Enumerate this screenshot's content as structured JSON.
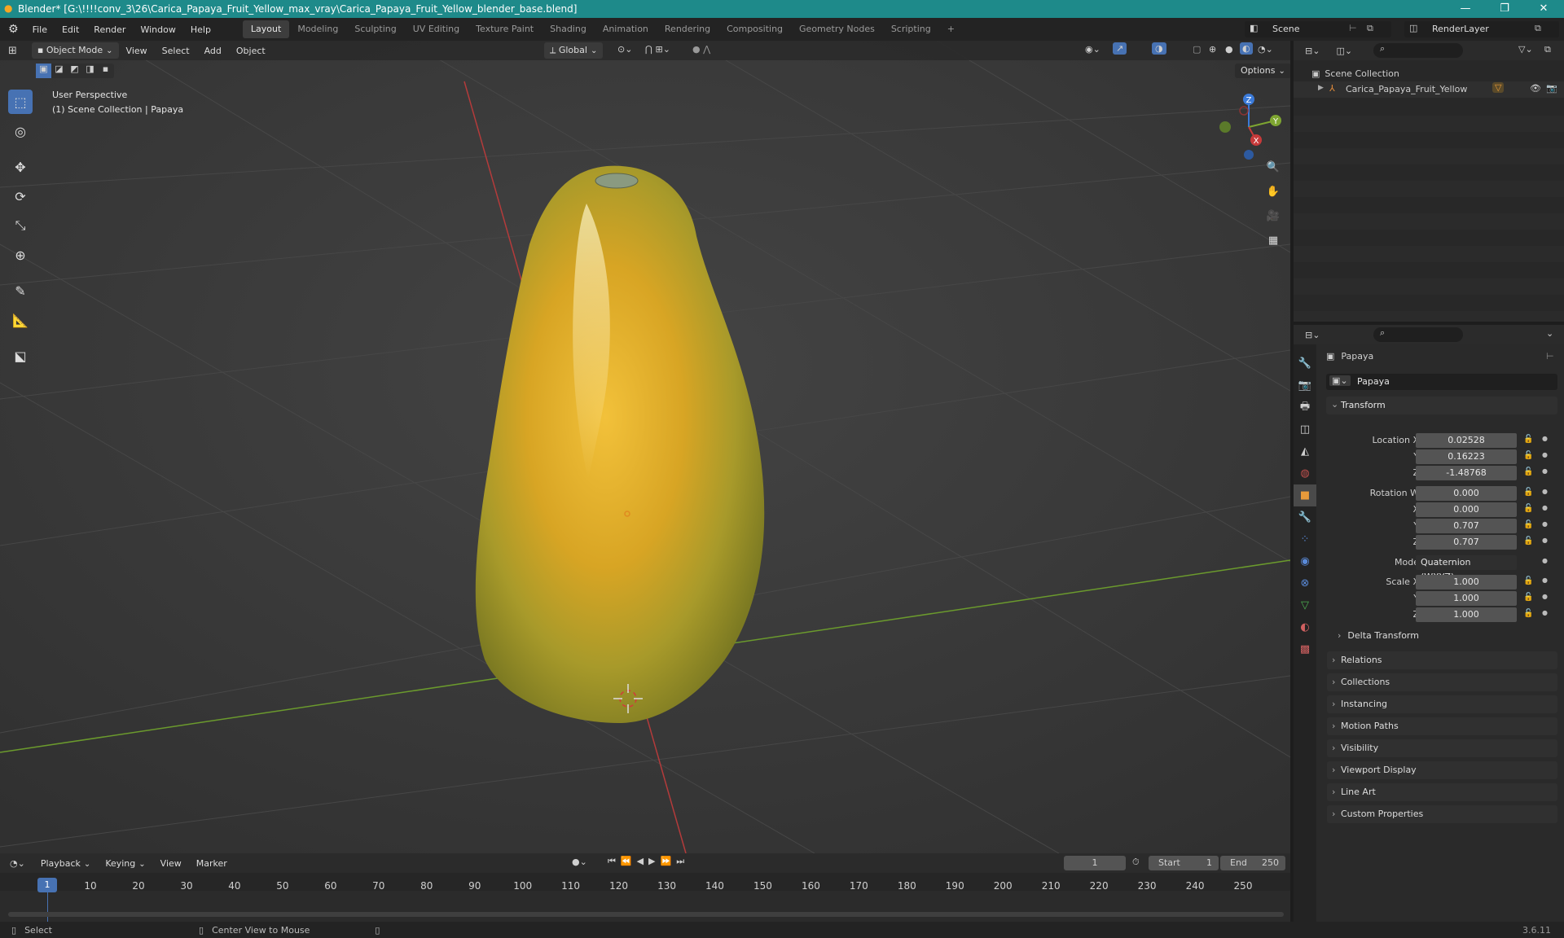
{
  "titlebar": {
    "title": "Blender* [G:\\!!!!conv_3\\26\\Carica_Papaya_Fruit_Yellow_max_vray\\Carica_Papaya_Fruit_Yellow_blender_base.blend]"
  },
  "menus": [
    "File",
    "Edit",
    "Render",
    "Window",
    "Help"
  ],
  "workspaces": [
    "Layout",
    "Modeling",
    "Sculpting",
    "UV Editing",
    "Texture Paint",
    "Shading",
    "Animation",
    "Rendering",
    "Compositing",
    "Geometry Nodes",
    "Scripting"
  ],
  "active_workspace": "Layout",
  "scene": {
    "name": "Scene",
    "view_layer": "RenderLayer"
  },
  "viewport": {
    "mode": "Object Mode",
    "menus": [
      "View",
      "Select",
      "Add",
      "Object"
    ],
    "orientation": "Global",
    "options_label": "Options",
    "overlay_title": "User Perspective",
    "overlay_subtitle": "(1) Scene Collection | Papaya",
    "gizmo": {
      "x": "X",
      "y": "Y",
      "z": "Z"
    }
  },
  "outliner": {
    "root": "Scene Collection",
    "items": [
      {
        "name": "Carica_Papaya_Fruit_Yellow"
      }
    ]
  },
  "properties": {
    "object_name": "Papaya",
    "datablock": "Papaya",
    "transform_label": "Transform",
    "location": {
      "label": "Location X",
      "x": "0.02528",
      "y": "0.16223",
      "z": "-1.48768"
    },
    "rotation": {
      "label": "Rotation W",
      "w": "0.000",
      "x": "0.000",
      "y": "0.707",
      "z": "0.707"
    },
    "mode": {
      "label": "Mode",
      "value": "Quaternion (WXYZ)"
    },
    "scale": {
      "label": "Scale X",
      "x": "1.000",
      "y": "1.000",
      "z": "1.000"
    },
    "axis_labels": {
      "x": "X",
      "y": "Y",
      "z": "Z"
    },
    "delta": "Delta Transform",
    "panels": [
      "Relations",
      "Collections",
      "Instancing",
      "Motion Paths",
      "Visibility",
      "Viewport Display",
      "Line Art",
      "Custom Properties"
    ]
  },
  "timeline": {
    "menus": [
      "Playback",
      "Keying",
      "View",
      "Marker"
    ],
    "current_frame": "1",
    "start_label": "Start",
    "start": "1",
    "end_label": "End",
    "end": "250",
    "ticks": [
      "10",
      "20",
      "30",
      "40",
      "50",
      "60",
      "70",
      "80",
      "90",
      "100",
      "110",
      "120",
      "130",
      "140",
      "150",
      "160",
      "170",
      "180",
      "190",
      "200",
      "210",
      "220",
      "230",
      "240",
      "250"
    ]
  },
  "statusbar": {
    "select": "Select",
    "center": "Center View to Mouse",
    "version": "3.6.11"
  },
  "colors": {
    "accent": "#4772b3",
    "titlebar": "#1e8a8a",
    "x_axis": "#c83a3a",
    "y_axis": "#7ea531",
    "z_axis": "#3b7ad8"
  }
}
